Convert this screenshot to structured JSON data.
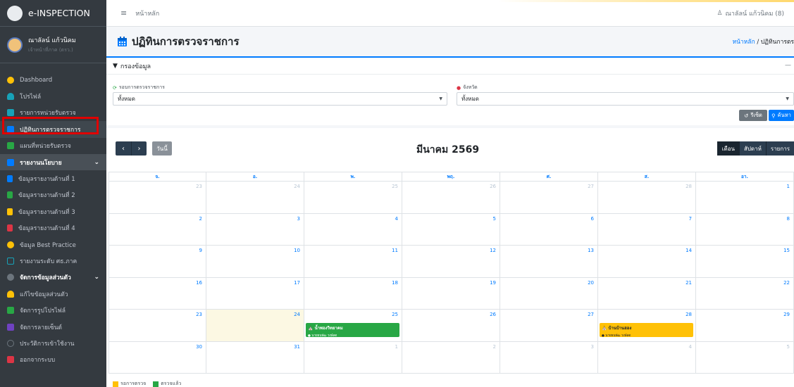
{
  "brand": {
    "name": "e-INSPECTION"
  },
  "user": {
    "name": "ณาลัลน์ แก้วนิคม",
    "sub": "เจ้าหน้าที่ภาค (ตรว.)"
  },
  "sidebar": {
    "items": [
      {
        "label": "Dashboard",
        "icon": "dashboard-icon",
        "color": "#ffc107"
      },
      {
        "label": "โปรไฟล์",
        "icon": "user-icon",
        "color": "#17a2b8"
      },
      {
        "label": "รายการหน่วยรับตรวจ",
        "icon": "list-icon",
        "color": "#17a2b8"
      },
      {
        "label": "ปฏิทินการตรวจราชการ",
        "icon": "calendar-icon",
        "color": "#007bff"
      },
      {
        "label": "แผนที่หน่วยรับตรวจ",
        "icon": "map-icon",
        "color": "#28a745"
      },
      {
        "label": "รายงานนโยบาย",
        "icon": "report-icon",
        "color": "#007bff"
      },
      {
        "label": "ข้อมูลรายงานด้านที่ 1",
        "icon": "file-icon",
        "color": "#007bff"
      },
      {
        "label": "ข้อมูลรายงานด้านที่ 2",
        "icon": "file-icon",
        "color": "#28a745"
      },
      {
        "label": "ข้อมูลรายงานด้านที่ 3",
        "icon": "file-icon",
        "color": "#ffc107"
      },
      {
        "label": "ข้อมูลรายงานด้านที่ 4",
        "icon": "file-icon",
        "color": "#dc3545"
      },
      {
        "label": "ข้อมูล Best Practice",
        "icon": "award-icon",
        "color": "#ffc107"
      },
      {
        "label": "รายงานระดับ ศธ.ภาค",
        "icon": "chart-icon",
        "color": "#17a2b8"
      },
      {
        "label": "จัดการข้อมูลส่วนตัว",
        "icon": "gears-icon",
        "color": "#6c757d"
      },
      {
        "label": "แก้ไขข้อมูลส่วนตัว",
        "icon": "user-edit-icon",
        "color": "#ffc107"
      },
      {
        "label": "จัดการรูปโปรไฟล์",
        "icon": "image-icon",
        "color": "#28a745"
      },
      {
        "label": "จัดการลายเซ็นต์",
        "icon": "signature-icon",
        "color": "#6f42c1"
      },
      {
        "label": "ประวัติการเข้าใช้งาน",
        "icon": "history-icon",
        "color": "#6c757d"
      },
      {
        "label": "ออกจากระบบ",
        "icon": "logout-icon",
        "color": "#dc3545"
      }
    ]
  },
  "topbar": {
    "menu_icon": "≡",
    "home": "หน้าหลัก",
    "user": "ณาลัลน์ แก้วนิคม (8)"
  },
  "page": {
    "title": "ปฏิทินการตรวจราชการ",
    "breadcrumb_home": "หน้าหลัก",
    "breadcrumb_current": "ปฏิทินการตร"
  },
  "filter": {
    "title": "กรองข้อมูล",
    "round_label": "รอบการตรวจราชการ",
    "round_value": "ทั้งหมด",
    "province_label": "จังหวัด",
    "province_value": "ทั้งหมด",
    "reset_label": "รีเซ็ต",
    "search_label": "ค้นหา"
  },
  "calendar": {
    "title": "มีนาคม 2569",
    "today_label": "วันนี้",
    "views": [
      "เดือน",
      "สัปดาห์",
      "รายการ"
    ],
    "dow": [
      "จ.",
      "อ.",
      "พ.",
      "พฤ.",
      "ศ.",
      "ส.",
      "อา."
    ],
    "weeks": [
      [
        "23",
        "24",
        "25",
        "26",
        "27",
        "28",
        "1"
      ],
      [
        "2",
        "3",
        "4",
        "5",
        "6",
        "7",
        "8"
      ],
      [
        "9",
        "10",
        "11",
        "12",
        "13",
        "14",
        "15"
      ],
      [
        "16",
        "17",
        "18",
        "19",
        "20",
        "21",
        "22"
      ],
      [
        "23",
        "24",
        "25",
        "26",
        "27",
        "28",
        "29"
      ],
      [
        "30",
        "31",
        "1",
        "2",
        "3",
        "4",
        "5"
      ]
    ],
    "events": [
      {
        "title": "น้ำพองวิทยาคม",
        "sub": "นายธนพัฒ วงษ์ลด",
        "color": "#28a745"
      },
      {
        "title": "บ้านบ้านฮอง",
        "sub": "นายธนพัฒ วงษ์ลด",
        "color": "#ffc107"
      }
    ]
  },
  "legend": {
    "pending": "รอการตรวจ",
    "done": "ตรวจแล้ว",
    "pending_color": "#ffc107",
    "done_color": "#28a745"
  }
}
